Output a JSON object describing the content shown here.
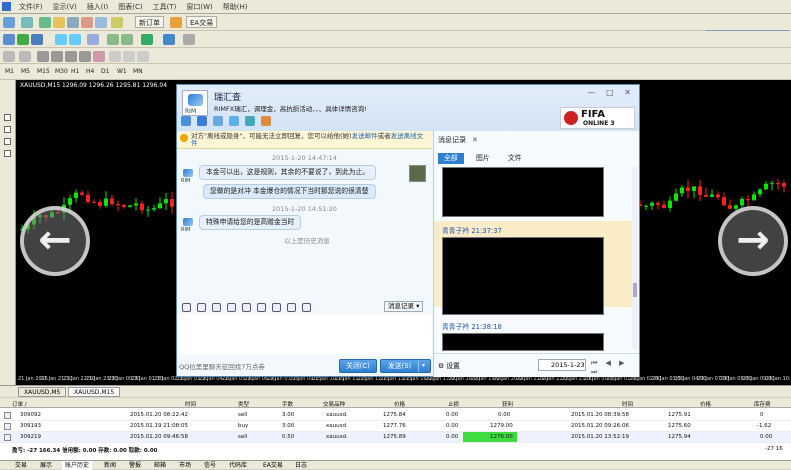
{
  "menubar": {
    "items": [
      "文件(F)",
      "显示(V)",
      "插入(I)",
      "图表(C)",
      "工具(T)",
      "窗口(W)",
      "帮助(H)"
    ]
  },
  "toolbar": {
    "new_order": "新订单",
    "ea_trading": "EA交易"
  },
  "timeframes": [
    "M1",
    "M5",
    "M15",
    "M30",
    "H1",
    "H4",
    "D1",
    "W1",
    "MN"
  ],
  "chart": {
    "info": "XAUUSD,M15  1296.09 1296.26 1295.81 1296.04",
    "x_ticks": [
      "21 Jan 2015",
      "21 Jan 21:30",
      "21 Jan 22:30",
      "21 Jan 23:30",
      "22 Jan 00:30",
      "22 Jan 01:30",
      "22 Jan 02:30",
      "22 Jan 03:30",
      "22 Jan 04:30",
      "22 Jan 05:30",
      "22 Jan 06:30",
      "22 Jan 07:15",
      "22 Jan 09:15",
      "22 Jan 10:15",
      "22 Jan 11:15",
      "22 Jan 12:15",
      "22 Jan 13:15",
      "22 Jan 16:00",
      "22 Jan 17:00",
      "22 Jan 18:00",
      "22 Jan 19:00",
      "22 Jan 20:00",
      "22 Jan 21:00",
      "22 Jan 22:00",
      "22 Jan 23:00",
      "23 Jan 00:00",
      "23 Jan 01:00",
      "23 Jan 02:00",
      "23 Jan 03:00",
      "23 Jan 04:00",
      "23 Jan 07:00",
      "23 Jan 08:00",
      "23 Jan 09:00",
      "23 Jan 10:00"
    ],
    "bull_color": "#00e600",
    "bear_color": "#ff2020"
  },
  "chart_tabs": [
    "XAUUSD,M5",
    "XAUUSD,M15"
  ],
  "qq": {
    "name": "瑞汇查",
    "avatar_label": "RIM",
    "signature": "RIMFX瑞汇，调理金，高抗损活动、、、具体详情咨询!",
    "window_controls": "— □ ✕",
    "fifa_title": "FIFA",
    "fifa_sub": "ONLINE 3",
    "warning": "对方\"离线或隐身\"，可能无法立即回复，您可以给他(她)",
    "warning_link1": "发送邮件",
    "warning_mid": "或者",
    "warning_link2": "发送离线文件",
    "messages": [
      {
        "time": "2015-1-20 14:47:14"
      },
      {
        "text": "本金可以出，这是规则，其余的不要说了，到此为止。"
      },
      {
        "text": "您做的是对冲  本金爆仓的情况下当时那您说的很清楚"
      },
      {
        "time": "2015-1-20 14:51:20"
      },
      {
        "text": "特殊申请给您的是高赠金当时"
      }
    ],
    "history_line": "以上是历史消息",
    "msg_record_btn": "消息记录 ▾",
    "footer_text": "QQ拉黑里聊天征回找7万点券",
    "close_btn": "关闭(C)",
    "send_btn": "发送(S)",
    "send_dd": "▾"
  },
  "rp": {
    "title": "消息记录",
    "title_close": "✕",
    "tabs": [
      "全部",
      "图片",
      "文件"
    ],
    "senders": [
      "青青子衿 21:37:37",
      "青青子衿 21:38:18"
    ],
    "settings": "⚙ 设置",
    "date": "2015-1-23",
    "nav": "⏮ ◀ ▶ ⏭"
  },
  "orders": {
    "headers": [
      "订单 /",
      "时间",
      "类型",
      "手数",
      "交易品种",
      "价格",
      "止损",
      "获利",
      "时间",
      "价格",
      "库存费"
    ],
    "rows": [
      [
        "309092",
        "2015.01.20 08:22:42",
        "sell",
        "3.00",
        "xauusd.",
        "1275.84",
        "0.00",
        "0.00",
        "2015.01.20 08:39:58",
        "1275.91",
        "0"
      ],
      [
        "309193",
        "2015.01.19 21:08:05",
        "buy",
        "3.00",
        "xauusd.",
        "1277.76",
        "0.00",
        "1279.00",
        "2015.01.20 09:26:06",
        "1275.60",
        "-1.62"
      ],
      [
        "309219",
        "2015.01.20 09:46:58",
        "sell",
        "0.50",
        "xauusd.",
        "1275.89",
        "0.00",
        "1276.00",
        "2015.01.20 13:52:19",
        "1275.94",
        "0.00"
      ]
    ],
    "summary": "盈亏: -27 166.34  信用额: 0.00  存款: 0.00  取款: 0.00",
    "summary_right": "-27 16"
  },
  "bottom_tabs": [
    "交易",
    "展示",
    "账户历史",
    "新闻",
    "警报",
    "邮箱",
    "市场",
    "信号",
    "代码库",
    "EA交易",
    "日志"
  ]
}
